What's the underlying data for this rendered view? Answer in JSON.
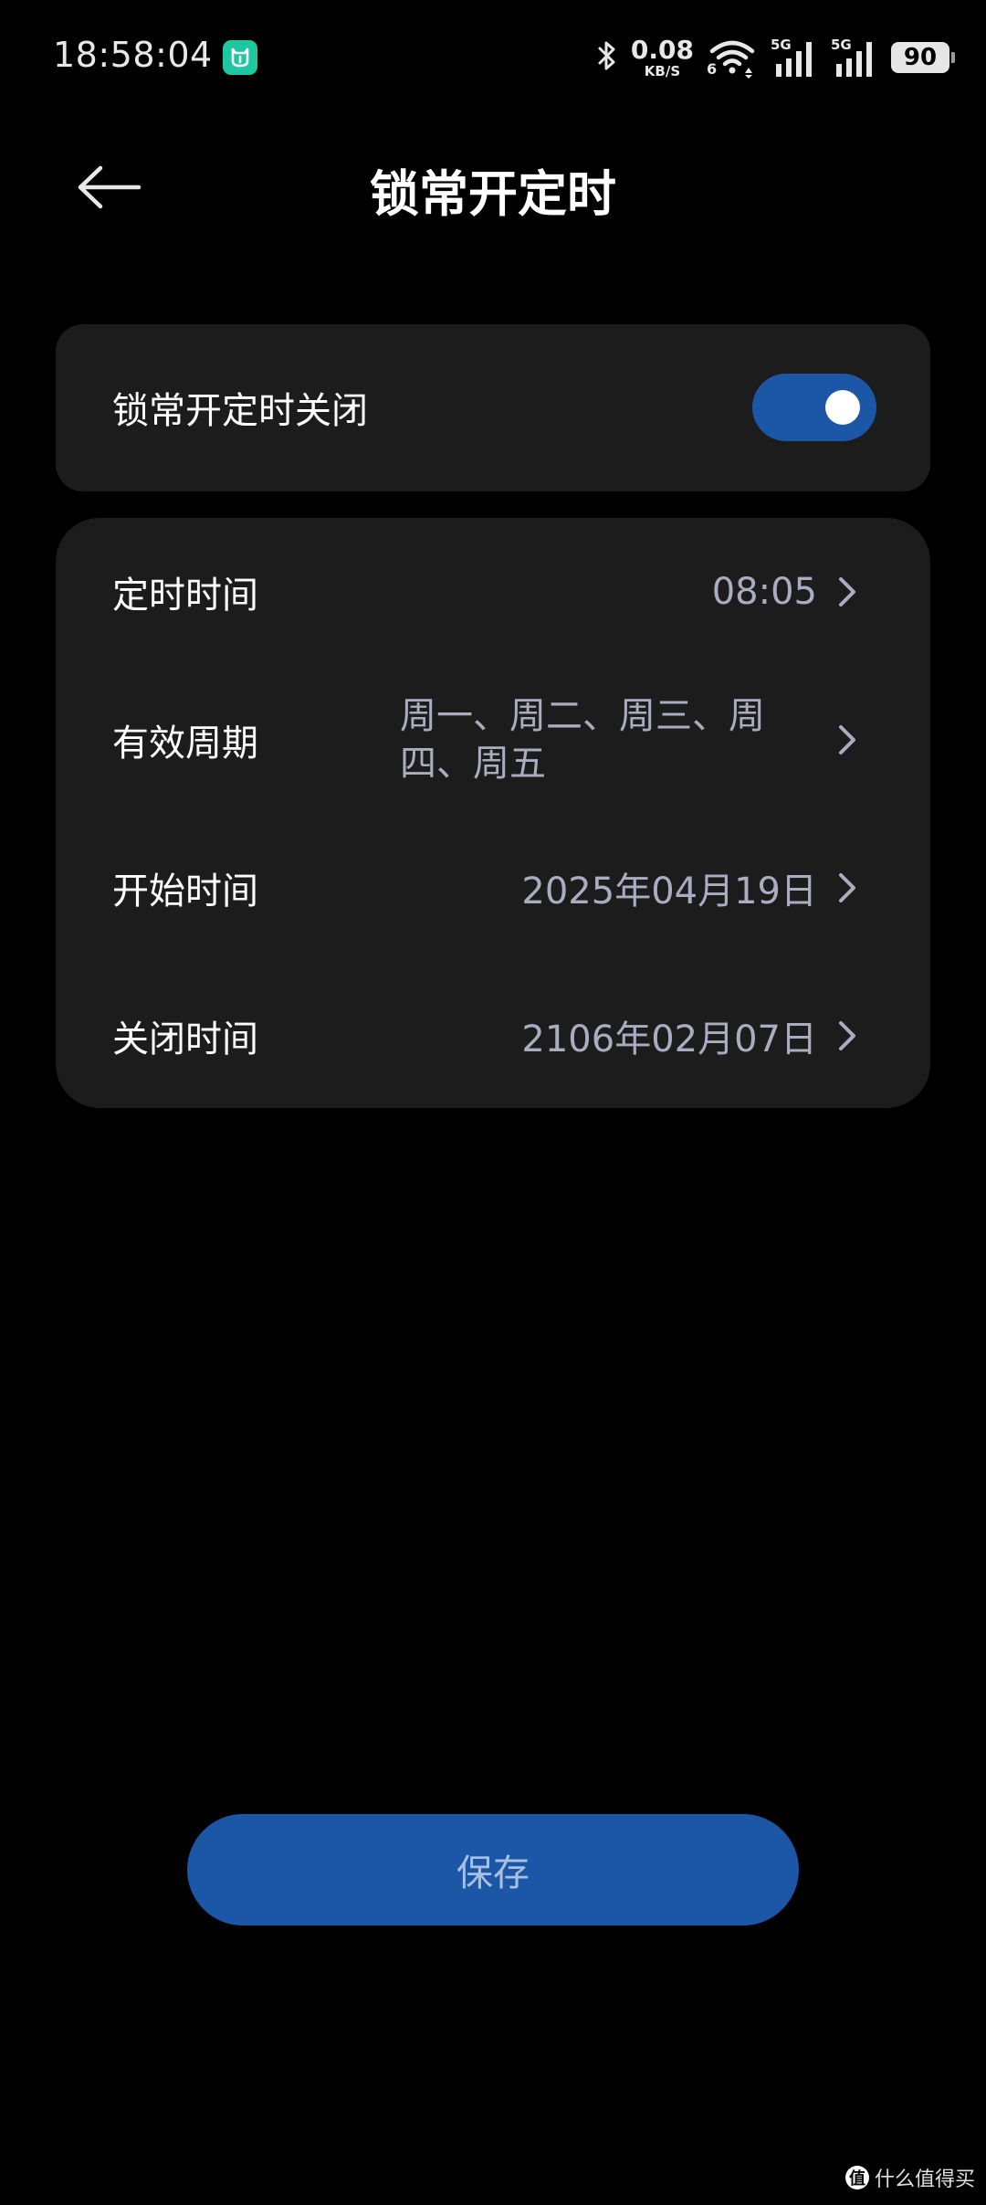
{
  "status_bar": {
    "time": "18:58:04",
    "net_speed_value": "0.08",
    "net_speed_unit": "KB/S",
    "wifi_label": "6",
    "sim1_label": "5G",
    "sim2_label": "5G",
    "battery_level": "90"
  },
  "header": {
    "title": "锁常开定时"
  },
  "toggle_card": {
    "label": "锁常开定时关闭",
    "enabled": true
  },
  "settings": {
    "rows": [
      {
        "label": "定时时间",
        "value": "08:05"
      },
      {
        "label": "有效周期",
        "value": "周一、周二、周三、周四、周五"
      },
      {
        "label": "开始时间",
        "value": "2025年04月19日"
      },
      {
        "label": "关闭时间",
        "value": "2106年02月07日"
      }
    ]
  },
  "actions": {
    "save_label": "保存"
  },
  "watermark": {
    "badge": "值",
    "text": "什么值得买"
  },
  "colors": {
    "background": "#000000",
    "card": "#1c1c1c",
    "accent": "#1c56a6",
    "value_text": "#a9adbf",
    "save_text": "#a9c0e3",
    "app_badge": "#1fc7a0"
  }
}
